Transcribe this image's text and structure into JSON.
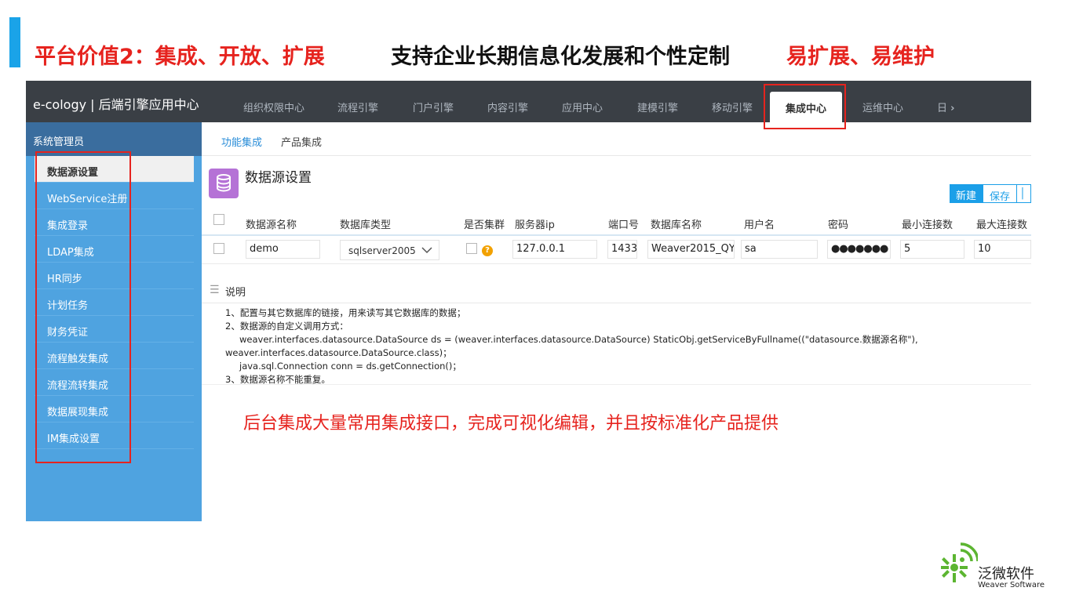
{
  "slide": {
    "title_left": "平台价值2：集成、开放、扩展",
    "title_mid": "支持企业长期信息化发展和个性定制",
    "title_right": "易扩展、易维护",
    "caption": "后台集成大量常用集成接口，完成可视化编辑，并且按标准化产品提供",
    "accent_color": "#1aa3e8",
    "highlight_color": "#e6231e"
  },
  "app": {
    "brand": "e-cology | 后端引擎应用中心",
    "user": "系统管理员"
  },
  "top_tabs": [
    {
      "label": "组织权限中心"
    },
    {
      "label": "流程引擎"
    },
    {
      "label": "门户引擎"
    },
    {
      "label": "内容引擎"
    },
    {
      "label": "应用中心"
    },
    {
      "label": "建模引擎"
    },
    {
      "label": "移动引擎"
    },
    {
      "label": "集成中心",
      "active": true
    },
    {
      "label": "运维中心"
    },
    {
      "label": "日"
    }
  ],
  "sub_tabs": [
    {
      "label": "功能集成",
      "active": true
    },
    {
      "label": "产品集成"
    }
  ],
  "sidebar": {
    "items": [
      {
        "label": "数据源设置",
        "active": true
      },
      {
        "label": "WebService注册"
      },
      {
        "label": "集成登录"
      },
      {
        "label": "LDAP集成"
      },
      {
        "label": "HR同步"
      },
      {
        "label": "计划任务"
      },
      {
        "label": "财务凭证"
      },
      {
        "label": "流程触发集成"
      },
      {
        "label": "流程流转集成"
      },
      {
        "label": "数据展现集成"
      },
      {
        "label": "IM集成设置"
      }
    ]
  },
  "page": {
    "title": "数据源设置",
    "icon": "database-icon",
    "buttons": {
      "new": "新建",
      "save": "保存"
    }
  },
  "table": {
    "headers": [
      "数据源名称",
      "数据库类型",
      "是否集群",
      "服务器ip",
      "端口号",
      "数据库名称",
      "用户名",
      "密码",
      "最小连接数",
      "最大连接数"
    ],
    "row": {
      "name": "demo",
      "db_type": "sqlserver2005",
      "cluster": false,
      "ip": "127.0.0.1",
      "port": "1433",
      "db_name": "Weaver2015_QY",
      "user": "sa",
      "password": "●●●●●●●",
      "min_conn": "5",
      "max_conn": "10"
    }
  },
  "notes": {
    "title": "说明",
    "lines": [
      "1、配置与其它数据库的链接，用来读写其它数据库的数据；",
      "2、数据源的自定义调用方式：",
      "weaver.interfaces.datasource.DataSource ds = (weaver.interfaces.datasource.DataSource) StaticObj.getServiceByFullname((\"datasource.数据源名称\"),",
      "weaver.interfaces.datasource.DataSource.class)；",
      "java.sql.Connection conn = ds.getConnection()；",
      "3、数据源名称不能重复。"
    ]
  },
  "logo": {
    "cn": "泛微软件",
    "en": "Weaver Software",
    "color": "#5cb531"
  }
}
